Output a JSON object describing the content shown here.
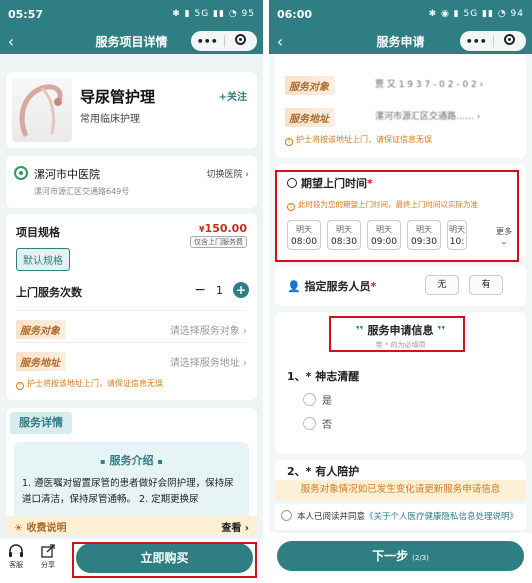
{
  "colors": {
    "primary": "#2f7e84",
    "highlight": "#d0121b",
    "warning": "#d87a1c",
    "price": "#c2301e"
  },
  "left": {
    "status": {
      "time": "05:57",
      "icons": "✱ ▮ 5G ▮▮ ◔ 95"
    },
    "nav": {
      "back": "‹",
      "title": "服务项目详情",
      "more": "•••",
      "capsule_close": "◎"
    },
    "product": {
      "name": "导尿管护理",
      "category": "常用临床护理",
      "follow": "+关注"
    },
    "hospital": {
      "name": "漯河市中医院",
      "address": "漯河市源汇区交通路649号",
      "switch": "切换医院 ›"
    },
    "spec": {
      "label": "项目规格",
      "price_symbol": "¥",
      "price": "150.00",
      "price_note": "仅含上门服务费",
      "default_option": "默认规格",
      "times_label": "上门服务次数",
      "minus": "−",
      "count": "1",
      "plus": "+",
      "target_label": "服务对象",
      "target_placeholder": "请选择服务对象 ›",
      "address_label": "服务地址",
      "address_placeholder": "请选择服务地址 ›",
      "tip": "护士将按该地址上门，请保证信息无误"
    },
    "detail": {
      "tab": "服务详情",
      "intro_title": "服务介绍",
      "intro_text": "1. 遵医嘱对留置尿管的患者做好会阴护理，保持尿道口清洁，保持尿管通畅。 2. 定期更换尿"
    },
    "charge": {
      "label": "收费说明",
      "link": "查看 ›"
    },
    "bottom": {
      "service": "客服",
      "share": "分享",
      "buy": "立即购买"
    }
  },
  "right": {
    "status": {
      "time": "06:00",
      "icons": "✱ ◉ ▮ 5G ▮▮ ◔ 94"
    },
    "nav": {
      "back": "‹",
      "title": "服务申请",
      "more": "•••",
      "capsule_close": "◎"
    },
    "form": {
      "target_label": "服务对象",
      "target_value": "贾 又 1 9 3 7 - 0 2 - 0 2 ›",
      "address_label": "服务地址",
      "address_value": "漯河市源汇区交通路……  ›",
      "tip": "护士将按该地址上门，请保证信息无误"
    },
    "expect": {
      "title": "期望上门时间",
      "required": "*",
      "note": "此时段为您的期望上门时间，最终上门时间以实际为准",
      "slots": [
        {
          "day": "明天",
          "time": "08:00"
        },
        {
          "day": "明天",
          "time": "08:30"
        },
        {
          "day": "明天",
          "time": "09:00"
        },
        {
          "day": "明天",
          "time": "09:30"
        },
        {
          "day": "明天",
          "time": "10:"
        }
      ],
      "more": "更多"
    },
    "staff": {
      "title": "指定服务人员",
      "required": "*",
      "options": [
        "无",
        "有"
      ]
    },
    "info": {
      "title": "服务申请信息",
      "subtitle": "带 * 的为必填项",
      "q1": "1、* 神志清醒",
      "q1_options": [
        "是",
        "否"
      ],
      "q2": "2、* 有人陪护"
    },
    "warning": "服务对象情况如已发生变化请更新服务申请信息",
    "agree": {
      "prefix": "本人已阅读并同意",
      "link": "《关于个人医疗健康隐私信息处理说明》"
    },
    "next": {
      "label": "下一步",
      "step": "(2/3)"
    }
  }
}
